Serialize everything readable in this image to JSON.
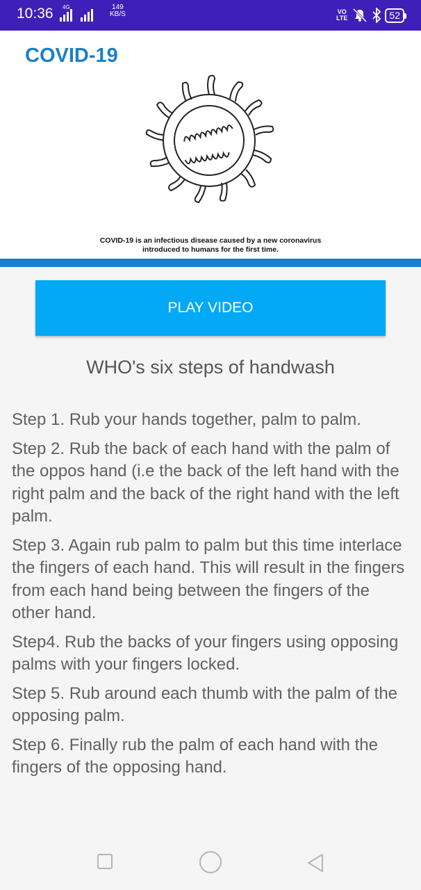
{
  "status_bar": {
    "time": "10:36",
    "network_tag": "4G",
    "speed_value": "149",
    "speed_unit": "KB/S",
    "volte_top": "VO",
    "volte_bottom": "LTE",
    "battery": "52"
  },
  "banner": {
    "title": "COVID-19",
    "caption_line1": "COVID-19 is an infectious disease caused by a new coronavirus",
    "caption_line2": "introduced to humans for the first time.",
    "title_color": "#1c7fc7"
  },
  "main": {
    "play_button_label": "PLAY VIDEO",
    "play_button_color": "#03a9f4",
    "heading": "WHO's six steps of handwash",
    "steps": [
      "Step 1. Rub your hands together, palm to palm.",
      "Step 2. Rub the back of each hand with the palm of the oppos hand (i.e the back of the left hand with the right palm and the back of the right hand with the left palm.",
      "Step 3. Again rub palm to palm but this time interlace the fingers of each hand. This will result in the fingers from each hand being between the fingers of the other hand.",
      "Step4. Rub the backs of your fingers using opposing palms with your fingers locked.",
      "Step 5. Rub around each thumb with the palm of the opposing palm.",
      "Step 6. Finally rub the palm of each hand with the fingers of the opposing hand."
    ]
  },
  "nav_bar": {
    "icons": [
      "recent-apps-icon",
      "home-icon",
      "back-icon"
    ]
  }
}
